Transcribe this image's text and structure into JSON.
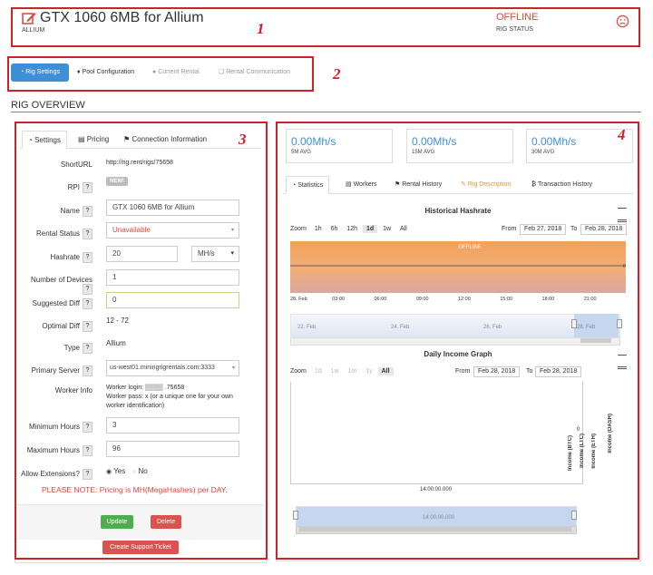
{
  "header": {
    "title": "GTX 1060 6MB for Allium",
    "algo": "ALLIUM",
    "status": "OFFLINE",
    "status_label": "RIG STATUS",
    "status_color": "#e0443a"
  },
  "markers": [
    "1",
    "2",
    "3",
    "4"
  ],
  "nav_tabs": [
    {
      "label": "Rig Settings",
      "active": true
    },
    {
      "label": "Pool Configuration"
    },
    {
      "label": "Current Rental"
    },
    {
      "label": "Rental Communication"
    }
  ],
  "overview_title": "RIG OVERVIEW",
  "settings_tabs": [
    "Settings",
    "Pricing",
    "Connection Information"
  ],
  "form": {
    "shorturl_label": "ShortURL",
    "shorturl_value": "http://rig.rent/rigs/75658",
    "rpi_label": "RPI",
    "rpi_badge": "NEW!",
    "name_label": "Name",
    "name_value": "GTX 1060 6MB for Allium",
    "rental_status_label": "Rental Status",
    "rental_status_value": "Unavailable",
    "hashrate_label": "Hashrate",
    "hashrate_value": "20",
    "hashrate_unit": "MH/s",
    "devices_label": "Number of Devices",
    "devices_value": "1",
    "suggested_label": "Suggested Diff",
    "suggested_value": "0",
    "optimal_label": "Optimal Diff",
    "optimal_value": "12 - 72",
    "type_label": "Type",
    "type_value": "Allium",
    "primary_label": "Primary Server",
    "primary_value": "us-west01.miningrigrentals.com:3333",
    "worker_label": "Worker Info",
    "worker_line1": "Worker login: ▒▒▒▒ .75658",
    "worker_line2": "Worker pass: x (or a unique one for your own worker identification)",
    "min_label": "Minimum Hours",
    "min_value": "3",
    "max_label": "Maximum Hours",
    "max_value": "96",
    "ext_label": "Allow Extensions?",
    "ext_yes": "Yes",
    "ext_no": "No",
    "note": "PLEASE NOTE: Pricing is MH(MegaHashes) per DAY.",
    "update_btn": "Update",
    "delete_btn": "Delete",
    "support_btn": "Create Support Ticket",
    "question_mark": "?"
  },
  "stats": [
    {
      "value": "0.00Mh/s",
      "label": "5M AVG"
    },
    {
      "value": "0.00Mh/s",
      "label": "15M AVG"
    },
    {
      "value": "0.00Mh/s",
      "label": "30M AVG"
    }
  ],
  "right_tabs": [
    "Statistics",
    "Workers",
    "Rental History",
    "Rig Description",
    "Transaction History"
  ],
  "hashrate_chart": {
    "title": "Historical Hashrate",
    "zoom_label": "Zoom",
    "zoom_options": [
      "1h",
      "6h",
      "12h",
      "1d",
      "1w",
      "All"
    ],
    "zoom_selected": "1d",
    "from_label": "From",
    "from_value": "Feb 27, 2018",
    "to_label": "To",
    "to_value": "Feb 28, 2018",
    "offline_text": "OFFLINE",
    "zero_label": "0",
    "x_ticks": [
      "28. Feb",
      "03:00",
      "06:00",
      "09:00",
      "12:00",
      "15:00",
      "18:00",
      "21:00"
    ],
    "nav_ticks": [
      "22. Feb",
      "24. Feb",
      "26. Feb",
      "28. Feb"
    ]
  },
  "income_chart": {
    "title": "Daily Income Graph",
    "zoom_label": "Zoom",
    "zoom_options": [
      "1d",
      "1w",
      "1m",
      "1y",
      "All"
    ],
    "zoom_selected": "All",
    "from_label": "From",
    "from_value": "Feb 28, 2018",
    "to_label": "To",
    "to_value": "Feb 28, 2018",
    "zero_label": "0",
    "axis_labels": [
      "Income (BTC)",
      "Income (LTC)",
      "Income (ETH)",
      "Income (DASH)"
    ],
    "x_tick": "14:00:00.000",
    "nav_tick": "14:00:00.000"
  },
  "chart_data": {
    "type": "area",
    "title": "Historical Hashrate",
    "x": [
      "28. Feb",
      "03:00",
      "06:00",
      "09:00",
      "12:00",
      "15:00",
      "18:00",
      "21:00"
    ],
    "series": [
      {
        "values": [
          0,
          0,
          0,
          0,
          0,
          0,
          0,
          0
        ]
      }
    ],
    "annotations": [
      "OFFLINE"
    ],
    "grid": false
  }
}
